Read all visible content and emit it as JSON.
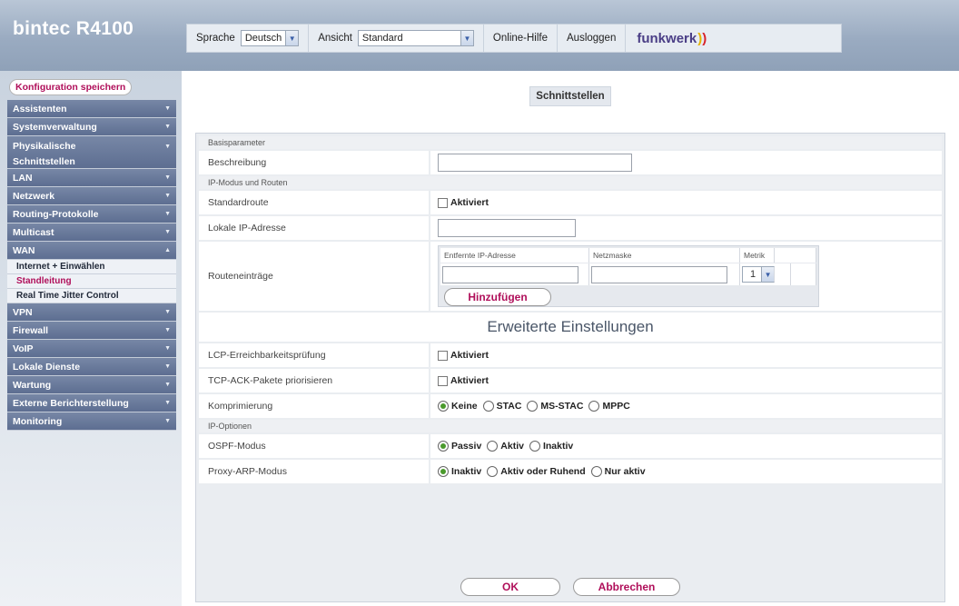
{
  "header": {
    "logo": "bintec R4100",
    "language_label": "Sprache",
    "language_value": "Deutsch",
    "view_label": "Ansicht",
    "view_value": "Standard",
    "help_label": "Online-Hilfe",
    "logout_label": "Ausloggen",
    "brand": "funkwerk"
  },
  "sidebar": {
    "save_label": "Konfiguration speichern",
    "items": [
      {
        "label": "Assistenten"
      },
      {
        "label": "Systemverwaltung"
      },
      {
        "label": "Physikalische",
        "label2": "Schnittstellen"
      },
      {
        "label": "LAN"
      },
      {
        "label": "Netzwerk"
      },
      {
        "label": "Routing-Protokolle"
      },
      {
        "label": "Multicast"
      },
      {
        "label": "WAN",
        "expanded": true
      }
    ],
    "wan_sub": [
      {
        "label": "Internet + Einwählen"
      },
      {
        "label": "Standleitung",
        "active": true
      },
      {
        "label": "Real Time Jitter Control"
      }
    ],
    "items_after": [
      {
        "label": "VPN"
      },
      {
        "label": "Firewall"
      },
      {
        "label": "VoIP"
      },
      {
        "label": "Lokale Dienste"
      },
      {
        "label": "Wartung"
      },
      {
        "label": "Externe Berichterstellung"
      },
      {
        "label": "Monitoring"
      }
    ]
  },
  "main": {
    "title": "Schnittstellen",
    "basic_section": "Basisparameter",
    "description_label": "Beschreibung",
    "description_value": "",
    "ip_section": "IP-Modus und Routen",
    "default_route_label": "Standardroute",
    "default_route_option": "Aktiviert",
    "local_ip_label": "Lokale IP-Adresse",
    "local_ip_value": "",
    "route_entries_label": "Routeneinträge",
    "route_cols": [
      "Entfernte IP-Adresse",
      "Netzmaske",
      "Metrik"
    ],
    "metric_value": "1",
    "add_button": "Hinzufügen",
    "advanced_title": "Erweiterte Einstellungen",
    "lcp_label": "LCP-Erreichbarkeitsprüfung",
    "lcp_option": "Aktiviert",
    "tcp_ack_label": "TCP-ACK-Pakete priorisieren",
    "tcp_ack_option": "Aktiviert",
    "compression_label": "Komprimierung",
    "compression_options": [
      "Keine",
      "STAC",
      "MS-STAC",
      "MPPC"
    ],
    "ip_options_section": "IP-Optionen",
    "ospf_label": "OSPF-Modus",
    "ospf_options": [
      "Passiv",
      "Aktiv",
      "Inaktiv"
    ],
    "proxy_arp_label": "Proxy-ARP-Modus",
    "proxy_arp_options": [
      "Inaktiv",
      "Aktiv oder Ruhend",
      "Nur aktiv"
    ],
    "ok_button": "OK",
    "cancel_button": "Abbrechen"
  }
}
